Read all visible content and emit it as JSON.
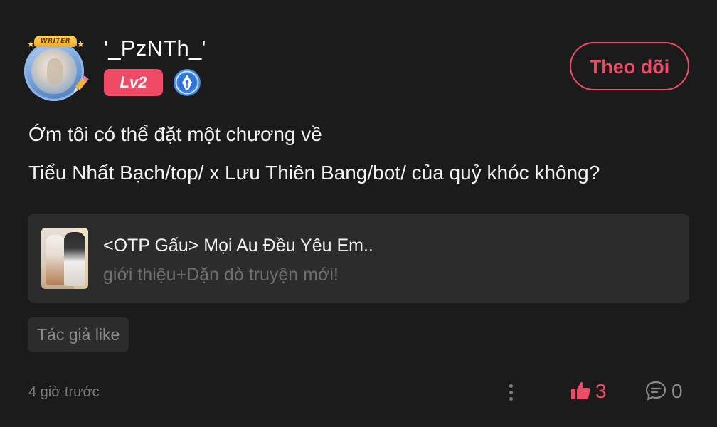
{
  "author": {
    "avatar_badge_text": "WRITER",
    "username": "'_PzNTh_'",
    "level": "Lv2",
    "verified_icon": "pen-nib-badge-icon"
  },
  "follow_button": {
    "label": "Theo dõi"
  },
  "post": {
    "lines": [
      "Ớm tôi có thể đặt một chương về",
      "Tiểu Nhất Bạch/top/ x Lưu Thiên Bang/bot/ của quỷ khóc không?"
    ]
  },
  "story_card": {
    "title": "<OTP Gấu> Mọi Au Đều Yêu Em..",
    "subtitle": "giới thiệu+Dặn dò truyện mới!"
  },
  "tag": {
    "label": "Tác giả like"
  },
  "footer": {
    "timestamp": "4 giờ trước",
    "likes": "3",
    "comments": "0"
  },
  "colors": {
    "background": "#1b1b1b",
    "accent": "#ef4b67",
    "card": "#2c2c2c",
    "muted_text": "#7d7d7d"
  }
}
